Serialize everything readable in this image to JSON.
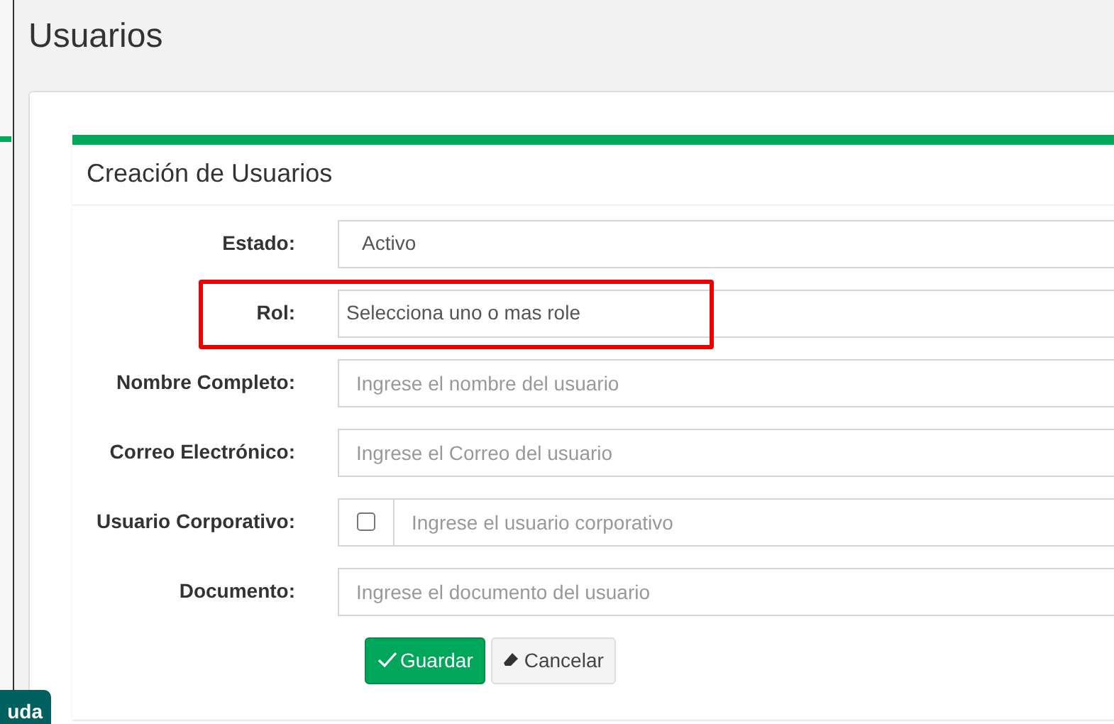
{
  "page_title": "Usuarios",
  "side_button": {
    "label": "uda"
  },
  "panel": {
    "title": "Creación de Usuarios",
    "fields": [
      {
        "kind": "select",
        "label": "Estado:",
        "value": "Activo",
        "highlighted": false
      },
      {
        "kind": "select",
        "label": "Rol:",
        "value": "Selecciona uno o mas role",
        "highlighted": true
      },
      {
        "kind": "input",
        "label": "Nombre Completo:",
        "placeholder": "Ingrese el nombre del usuario",
        "highlighted": false
      },
      {
        "kind": "input",
        "label": "Correo Electrónico:",
        "placeholder": "Ingrese el Correo del usuario",
        "highlighted": false
      },
      {
        "kind": "checkbox-input",
        "label": "Usuario Corporativo:",
        "checked": false,
        "placeholder": "Ingrese el usuario corporativo",
        "highlighted": false
      },
      {
        "kind": "input",
        "label": "Documento:",
        "placeholder": "Ingrese el documento del usuario",
        "highlighted": false
      }
    ],
    "buttons": [
      {
        "kind": "primary",
        "label": "Guardar"
      },
      {
        "kind": "secondary",
        "label": "Cancelar"
      }
    ]
  }
}
